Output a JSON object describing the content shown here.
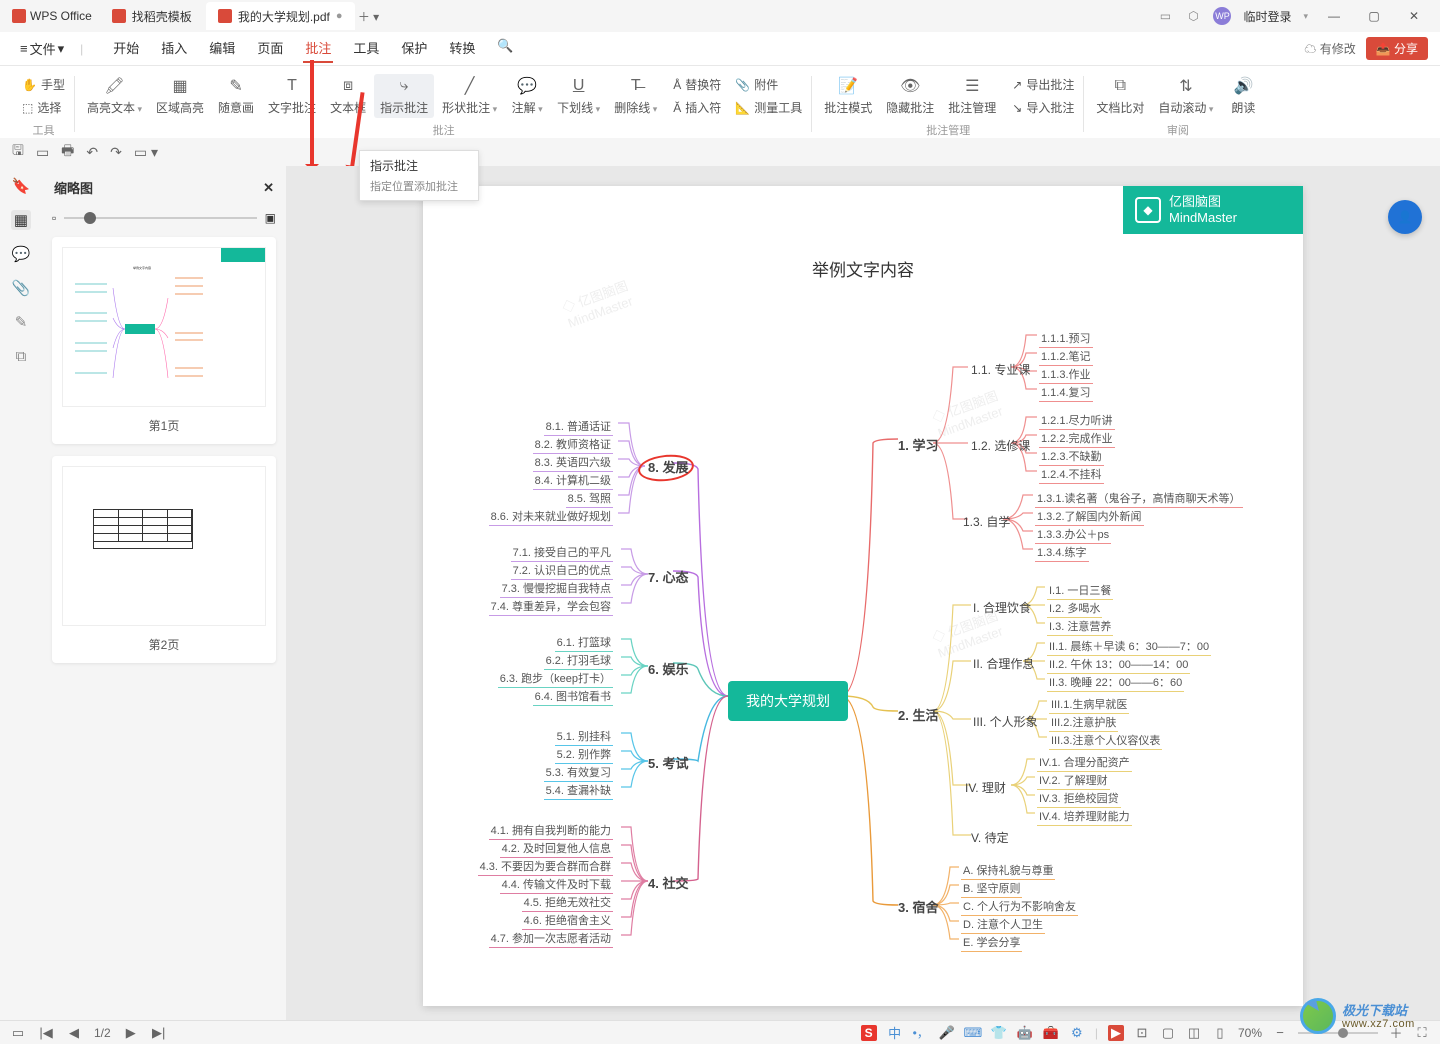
{
  "app": {
    "name": "WPS Office",
    "login": "临时登录",
    "modify": "有修改",
    "share": "分享"
  },
  "tabs": [
    {
      "label": "找稻壳模板",
      "icon": "#d94a3a"
    },
    {
      "label": "我的大学规划.pdf",
      "icon": "#d94a3a",
      "active": true
    }
  ],
  "menu": {
    "file": "文件",
    "tabs": [
      "开始",
      "插入",
      "编辑",
      "页面",
      "批注",
      "工具",
      "保护",
      "转换"
    ],
    "active": "批注"
  },
  "ribbon": {
    "tool": {
      "hand": "手型",
      "select": "选择",
      "group": "工具"
    },
    "annot": {
      "hl": "高亮文本",
      "area": "区域高亮",
      "draw": "随意画",
      "text": "文字批注",
      "box": "文本框",
      "point": "指示批注",
      "shape": "形状批注",
      "note": "注解",
      "ul": "下划线",
      "strike": "删除线",
      "repl": "替换符",
      "ins": "插入符",
      "att": "附件",
      "meas": "测量工具",
      "group": "批注"
    },
    "mgmt": {
      "mode": "批注模式",
      "hide": "隐藏批注",
      "mgr": "批注管理",
      "exp": "导出批注",
      "imp": "导入批注",
      "group": "批注管理"
    },
    "review": {
      "cmp": "文档比对",
      "scroll": "自动滚动",
      "read": "朗读",
      "group": "审阅"
    }
  },
  "tooltip": {
    "title": "指示批注",
    "desc": "指定位置添加批注"
  },
  "thumb": {
    "title": "缩略图",
    "p1": "第1页",
    "p2": "第2页"
  },
  "doc": {
    "title": "举例文字内容",
    "center": "我的大学规划",
    "brand": {
      "cn": "亿图脑图",
      "en": "MindMaster"
    },
    "left": {
      "n8": {
        "t": "8. 发展",
        "items": [
          "8.1. 普通话证",
          "8.2. 教师资格证",
          "8.3. 英语四六级",
          "8.4. 计算机二级",
          "8.5. 驾照",
          "8.6. 对未来就业做好规划"
        ]
      },
      "n7": {
        "t": "7. 心态",
        "items": [
          "7.1. 接受自己的平凡",
          "7.2. 认识自己的优点",
          "7.3. 慢慢挖掘自我特点",
          "7.4. 尊重差异，学会包容"
        ]
      },
      "n6": {
        "t": "6. 娱乐",
        "items": [
          "6.1. 打篮球",
          "6.2. 打羽毛球",
          "6.3. 跑步（keep打卡）",
          "6.4. 图书馆看书"
        ]
      },
      "n5": {
        "t": "5. 考试",
        "items": [
          "5.1. 别挂科",
          "5.2. 别作弊",
          "5.3. 有效复习",
          "5.4. 查漏补缺"
        ]
      },
      "n4": {
        "t": "4. 社交",
        "items": [
          "4.1. 拥有自我判断的能力",
          "4.2. 及时回复他人信息",
          "4.3. 不要因为要合群而合群",
          "4.4. 传输文件及时下载",
          "4.5. 拒绝无效社交",
          "4.6. 拒绝宿舍主义",
          "4.7. 参加一次志愿者活动"
        ]
      }
    },
    "right": {
      "n1": {
        "t": "1. 学习",
        "sub": [
          {
            "t": "1.1. 专业课",
            "items": [
              "1.1.1.预习",
              "1.1.2.笔记",
              "1.1.3.作业",
              "1.1.4.复习"
            ]
          },
          {
            "t": "1.2. 选修课",
            "items": [
              "1.2.1.尽力听讲",
              "1.2.2.完成作业",
              "1.2.3.不缺勤",
              "1.2.4.不挂科"
            ]
          },
          {
            "t": "1.3. 自学",
            "items": [
              "1.3.1.读名著（鬼谷子，高情商聊天术等）",
              "1.3.2.了解国内外新闻",
              "1.3.3.办公＋ps",
              "1.3.4.练字"
            ]
          }
        ]
      },
      "n2": {
        "t": "2. 生活",
        "sub": [
          {
            "t": "I. 合理饮食",
            "items": [
              "I.1. 一日三餐",
              "I.2. 多喝水",
              "I.3. 注意营养"
            ]
          },
          {
            "t": "II. 合理作息",
            "items": [
              "II.1. 晨练＋早读 6：30——7：00",
              "II.2. 午休 13：00——14：00",
              "II.3. 晚睡 22：00——6：60"
            ]
          },
          {
            "t": "III. 个人形象",
            "items": [
              "III.1.生病早就医",
              "III.2.注意护肤",
              "III.3.注意个人仪容仪表"
            ]
          },
          {
            "t": "IV. 理财",
            "items": [
              "IV.1. 合理分配资产",
              "IV.2. 了解理财",
              "IV.3. 拒绝校园贷",
              "IV.4. 培养理财能力"
            ]
          },
          {
            "t": "V. 待定",
            "items": []
          }
        ]
      },
      "n3": {
        "t": "3. 宿舍",
        "items": [
          "A. 保持礼貌与尊重",
          "B. 坚守原则",
          "C. 个人行为不影响舍友",
          "D. 注意个人卫生",
          "E. 学会分享"
        ]
      }
    }
  },
  "status": {
    "page": "1/2",
    "zoom": "70%"
  },
  "watermark": {
    "site": "极光下载站",
    "url": "www.xz7.com"
  }
}
